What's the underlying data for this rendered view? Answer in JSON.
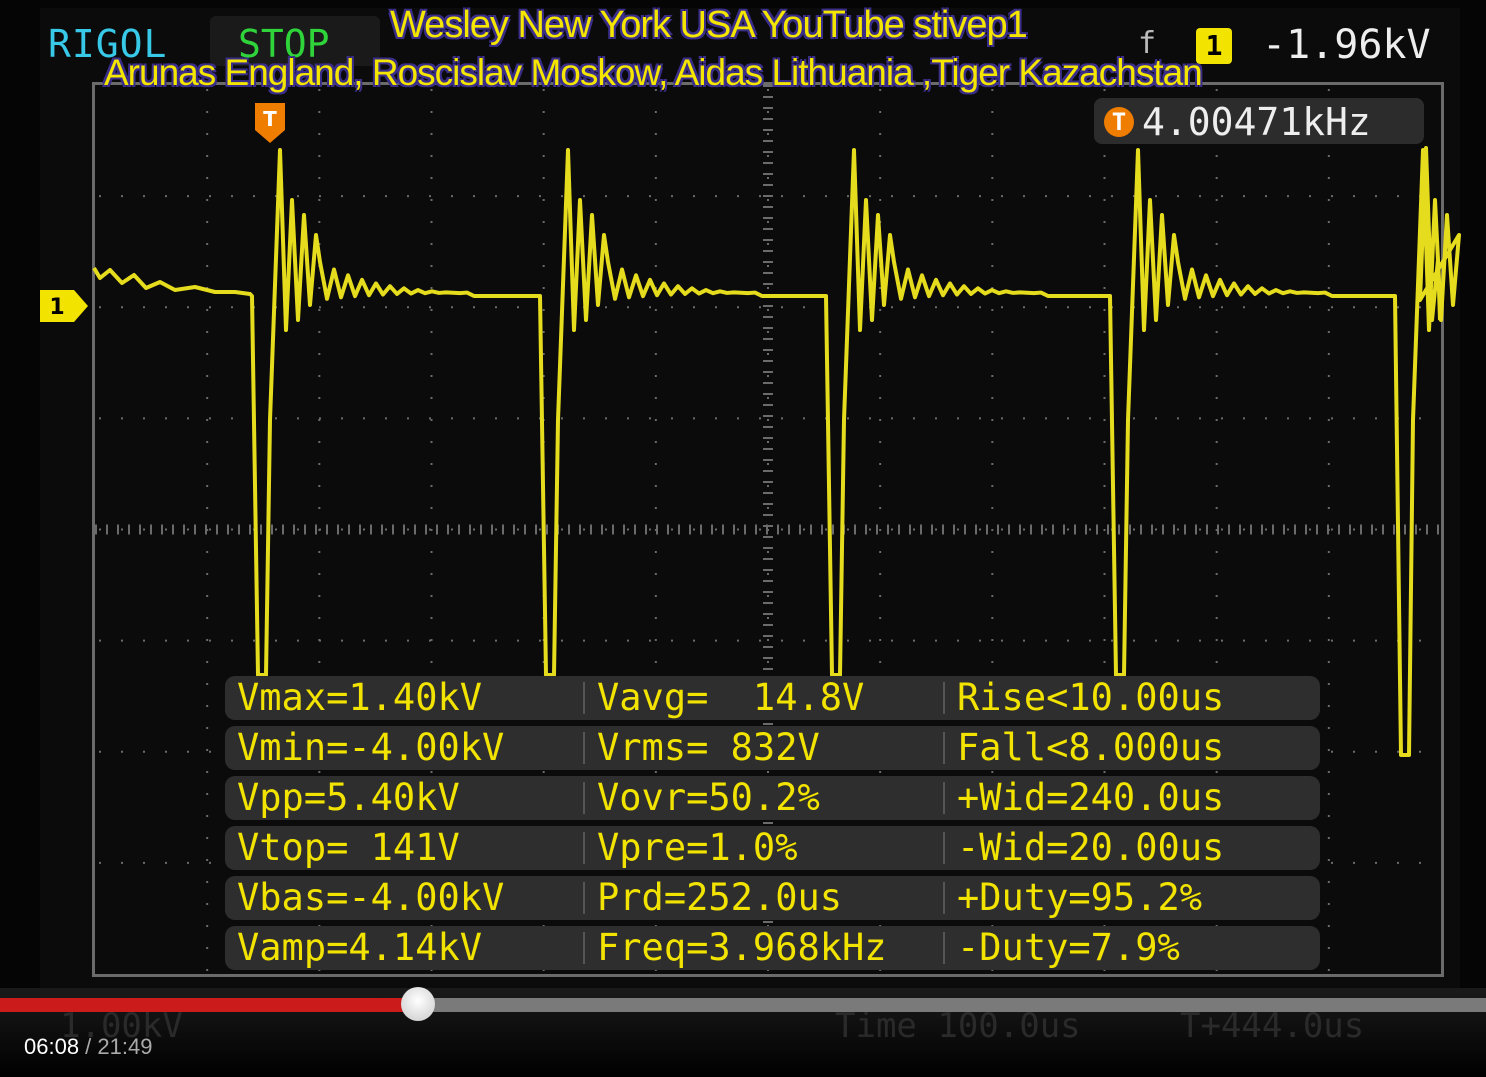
{
  "scope": {
    "brand": "RIGOL",
    "run_state": "STOP",
    "trigger": {
      "edge_symbol": "f",
      "channel": "1",
      "level": "-1.96kV",
      "marker": "T",
      "frequency": "4.00471kHz"
    },
    "channel_marker": "1",
    "bottom_ghost": {
      "ch_scale": "1.00kV",
      "timebase": "Time  100.0us",
      "offset": "T+444.0us"
    }
  },
  "overlay": {
    "line1": "Wesley New York USA YouTube stivep1",
    "line2": "Arunas England, Roscislav Moskow, Aidas Lithuania ,Tiger Kazachstan"
  },
  "measurements": [
    [
      "Vmax=1.40kV",
      "Vavg=  14.8V",
      "Rise<10.00us"
    ],
    [
      "Vmin=-4.00kV",
      "Vrms= 832V",
      "Fall<8.000us"
    ],
    [
      "Vpp=5.40kV",
      "Vovr=50.2%",
      "+Wid=240.0us"
    ],
    [
      "Vtop= 141V",
      "Vpre=1.0%",
      "-Wid=20.00us"
    ],
    [
      "Vbas=-4.00kV",
      "Prd=252.0us",
      "+Duty=95.2%"
    ],
    [
      "Vamp=4.14kV",
      "Freq=3.968kHz",
      "-Duty=7.9%"
    ]
  ],
  "player": {
    "current_time": "06:08",
    "separator": " / ",
    "duration": "21:49",
    "progress_fraction": 0.281
  },
  "colors": {
    "trace": "#e6dc1e",
    "grid": "#6b6b6b",
    "measure_text": "#f2e300",
    "progress": "#cc1b1b",
    "trigger_badge": "#ef7d00"
  }
}
